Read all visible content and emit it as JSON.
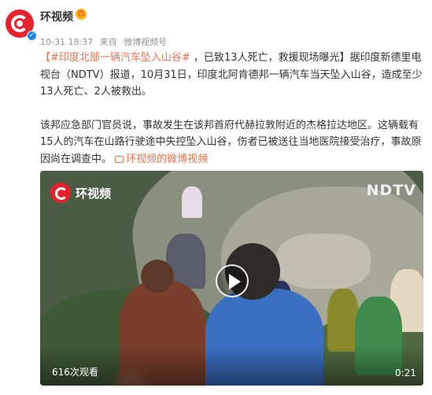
{
  "user": {
    "name": "环视频",
    "badge": "😍"
  },
  "meta": {
    "time": "10-31 18:37",
    "from": "来自",
    "source": "微博视频号"
  },
  "post": {
    "topic": "【#印度北部一辆汽车坠入山谷#",
    "p1_rest": " ，已致13人死亡，救援现场曝光】据印度新德里电视台（NDTV）报道，10月31日，印度北阿肯德邦一辆汽车当天坠入山谷，造成至少13人死亡、2人被救出。",
    "p2": "该邦应急部门官员说，事故发生在该邦首府代赫拉敦附近的杰格拉达地区。这辆载有15人的汽车在山路行驶途中失控坠入山谷，伤者已被送往当地医院接受治疗，事故原因尚在调查中。",
    "link_label": "环视频的微博视频"
  },
  "video": {
    "watermark": "环视频",
    "channel_logo": "NDTV",
    "views": "616次观看",
    "duration": "0:21"
  },
  "icons": {
    "avatar": "huanshipin-logo-icon",
    "verified": "verified-icon",
    "play": "play-icon",
    "video_link": "video-link-icon"
  },
  "colors": {
    "accent": "#eb7350",
    "brand_red": "#e8212c",
    "meta_gray": "#939393"
  }
}
